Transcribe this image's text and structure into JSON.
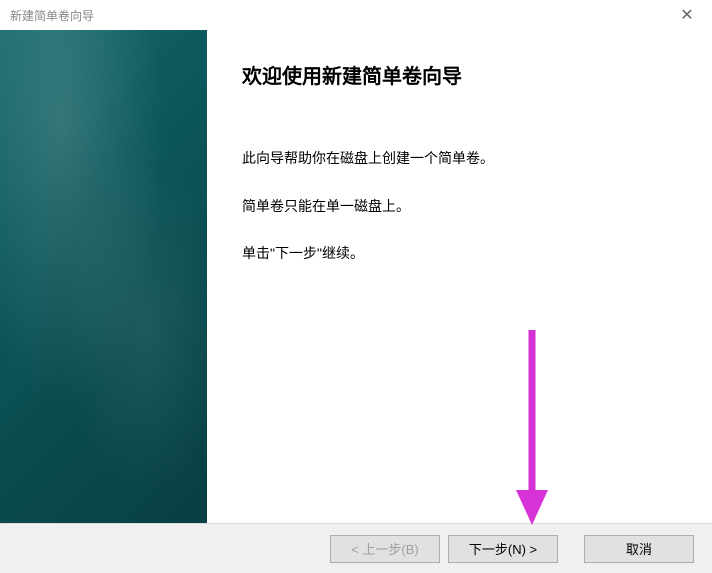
{
  "window": {
    "title": "新建简单卷向导"
  },
  "content": {
    "heading": "欢迎使用新建简单卷向导",
    "paragraph1": "此向导帮助你在磁盘上创建一个简单卷。",
    "paragraph2": "简单卷只能在单一磁盘上。",
    "paragraph3": "单击\"下一步\"继续。"
  },
  "buttons": {
    "back": "< 上一步(B)",
    "next": "下一步(N) >",
    "cancel": "取消"
  }
}
